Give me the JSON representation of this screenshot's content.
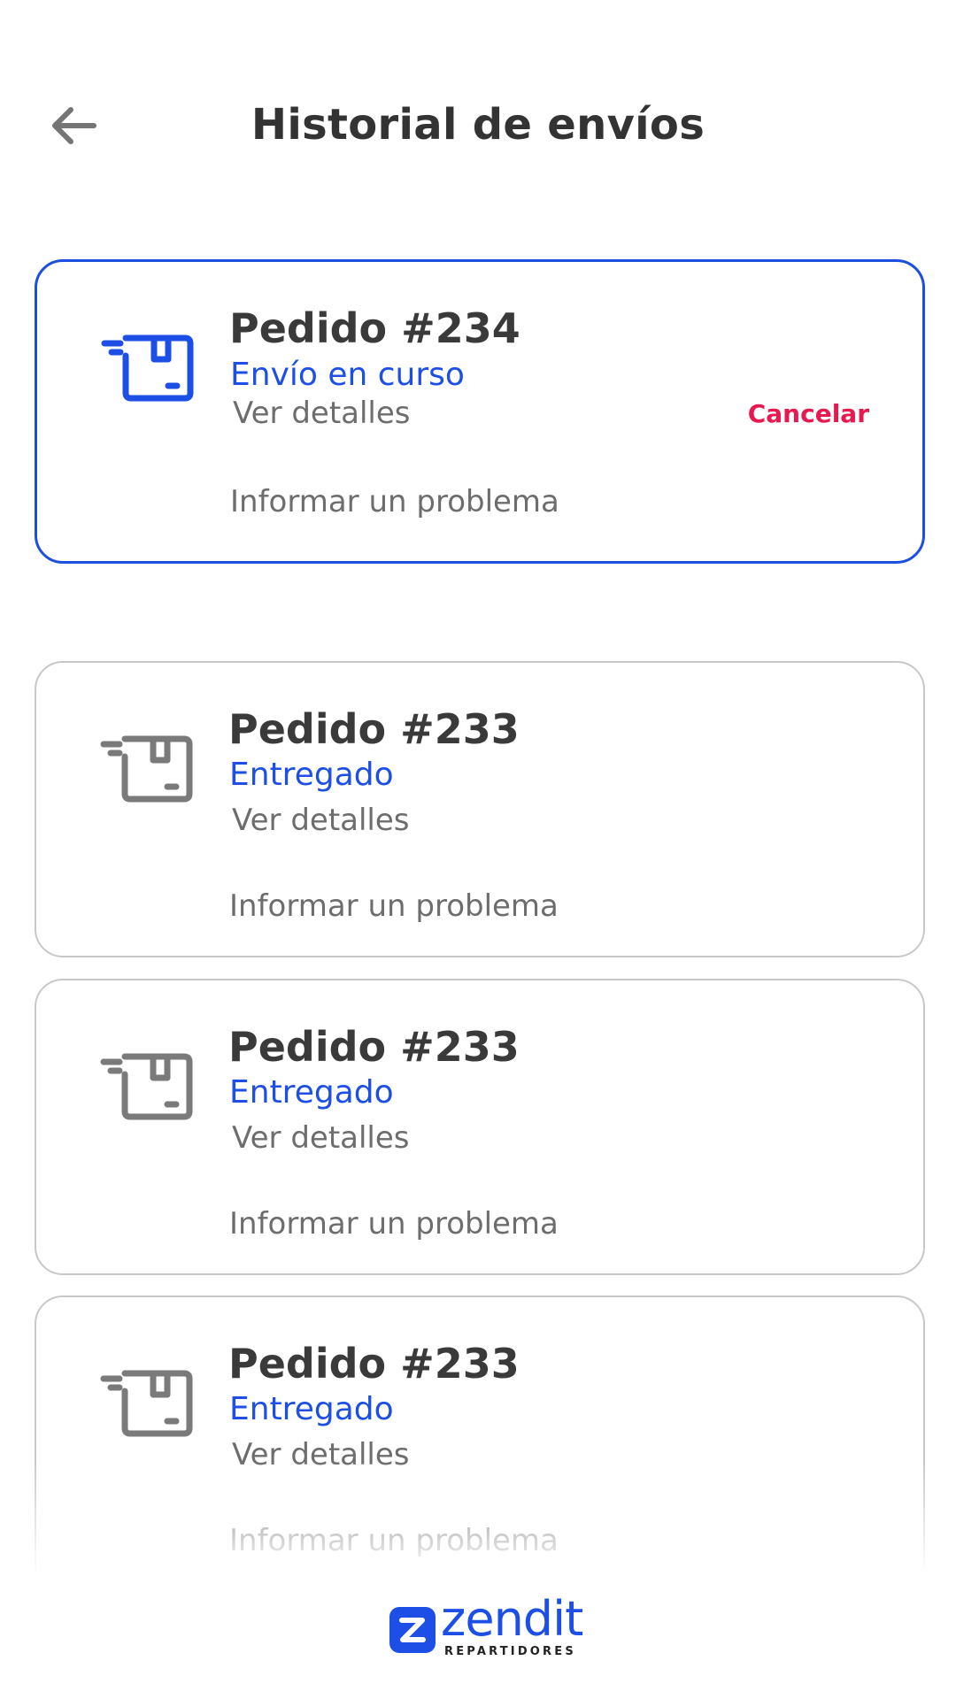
{
  "header": {
    "title": "Historial de envíos",
    "back_icon": "arrow-left-icon"
  },
  "colors": {
    "accent": "#1d4fe6",
    "cancel": "#e8194e",
    "muted": "#6d6d6d",
    "inactive_icon": "#7a7a7a"
  },
  "orders": [
    {
      "title": "Pedido #234",
      "status": "Envío en curso",
      "details_label": "Ver detalles",
      "problem_label": "Informar un problema",
      "cancel_label": "Cancelar",
      "icon": "package-delivery-icon"
    },
    {
      "title": "Pedido #233",
      "status": "Entregado",
      "details_label": "Ver detalles",
      "problem_label": "Informar un problema",
      "icon": "package-delivery-icon"
    },
    {
      "title": "Pedido #233",
      "status": "Entregado",
      "details_label": "Ver detalles",
      "problem_label": "Informar un problema",
      "icon": "package-delivery-icon"
    },
    {
      "title": "Pedido #233",
      "status": "Entregado",
      "details_label": "Ver detalles",
      "problem_label": "Informar un problema",
      "icon": "package-delivery-icon"
    }
  ],
  "footer": {
    "brand": "zendit",
    "brand_sub": "REPARTIDORES"
  }
}
